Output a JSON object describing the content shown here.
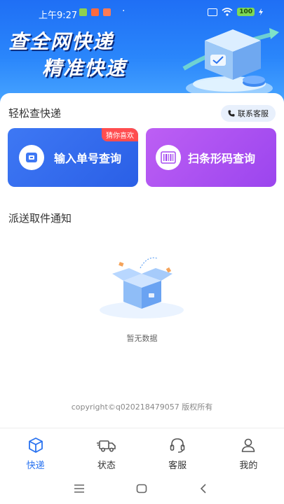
{
  "status_bar": {
    "time": "上午9:27",
    "battery": "100"
  },
  "hero": {
    "line1": "查全网快递",
    "line2": "精准快速"
  },
  "quick_query": {
    "title": "轻松查快递",
    "contact_label": "联系客服",
    "input_tile_label": "输入单号查询",
    "guess_badge": "猜你喜欢",
    "scan_tile_label": "扫条形码查询"
  },
  "notice": {
    "title": "派送取件通知",
    "empty_text": "暂无数据"
  },
  "copyright": "copyright©q020218479057 版权所有",
  "bottom_nav": {
    "items": [
      {
        "label": "快递",
        "icon": "box-icon",
        "active": true
      },
      {
        "label": "状态",
        "icon": "truck-icon",
        "active": false
      },
      {
        "label": "客服",
        "icon": "headset-icon",
        "active": false
      },
      {
        "label": "我的",
        "icon": "user-icon",
        "active": false
      }
    ]
  },
  "colors": {
    "brand_blue": "#2a73f0",
    "tile_blue": "#3e78f4",
    "tile_purple": "#b056f2",
    "badge_red": "#ff4d4f"
  }
}
